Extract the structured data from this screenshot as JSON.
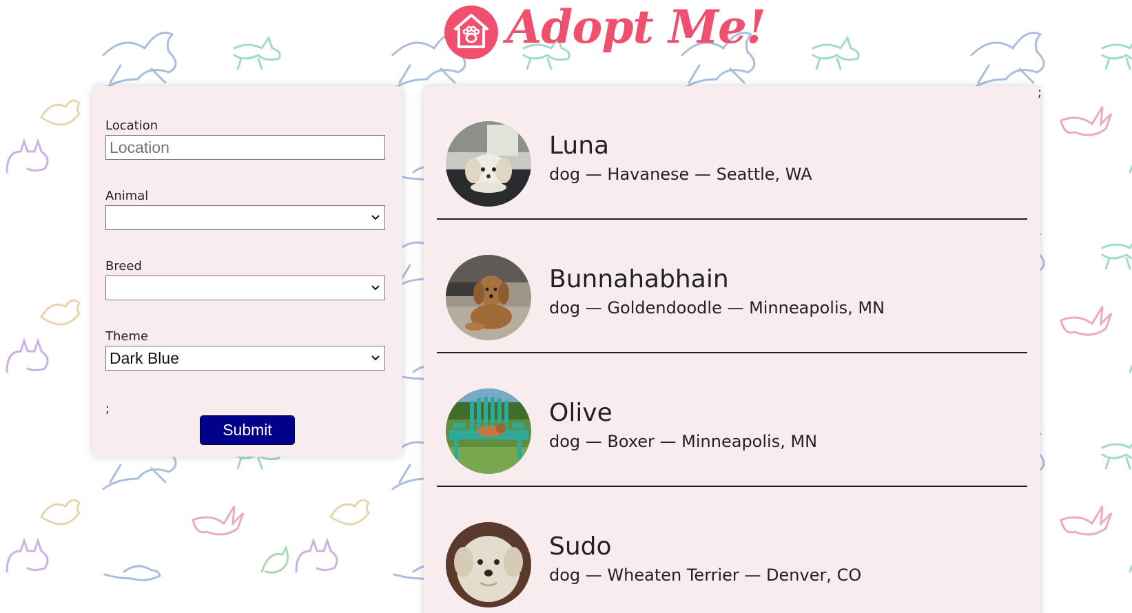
{
  "header": {
    "logo_text": "Adopt Me!",
    "logo_icon": "house-paw-icon"
  },
  "search": {
    "location_label": "Location",
    "location_placeholder": "Location",
    "location_value": "",
    "animal_label": "Animal",
    "animal_value": "",
    "breed_label": "Breed",
    "breed_value": "",
    "theme_label": "Theme",
    "theme_value": "Dark Blue",
    "stray_text": ";",
    "submit_label": "Submit",
    "submit_color": "#00008b"
  },
  "results": {
    "stray_text": ";",
    "pets": [
      {
        "name": "Luna",
        "description": "dog — Havanese — Seattle, WA",
        "photo": "havanese-dog-photo"
      },
      {
        "name": "Bunnahabhain",
        "description": "dog — Goldendoodle — Minneapolis, MN",
        "photo": "goldendoodle-dog-photo"
      },
      {
        "name": "Olive",
        "description": "dog — Boxer — Minneapolis, MN",
        "photo": "boxer-dog-on-bench-photo"
      },
      {
        "name": "Sudo",
        "description": "dog — Wheaten Terrier — Denver, CO",
        "photo": "wheaten-terrier-dog-photo"
      }
    ]
  },
  "colors": {
    "brand": "#f0506e",
    "card_background": "#f8ecef",
    "button": "#00008b"
  }
}
